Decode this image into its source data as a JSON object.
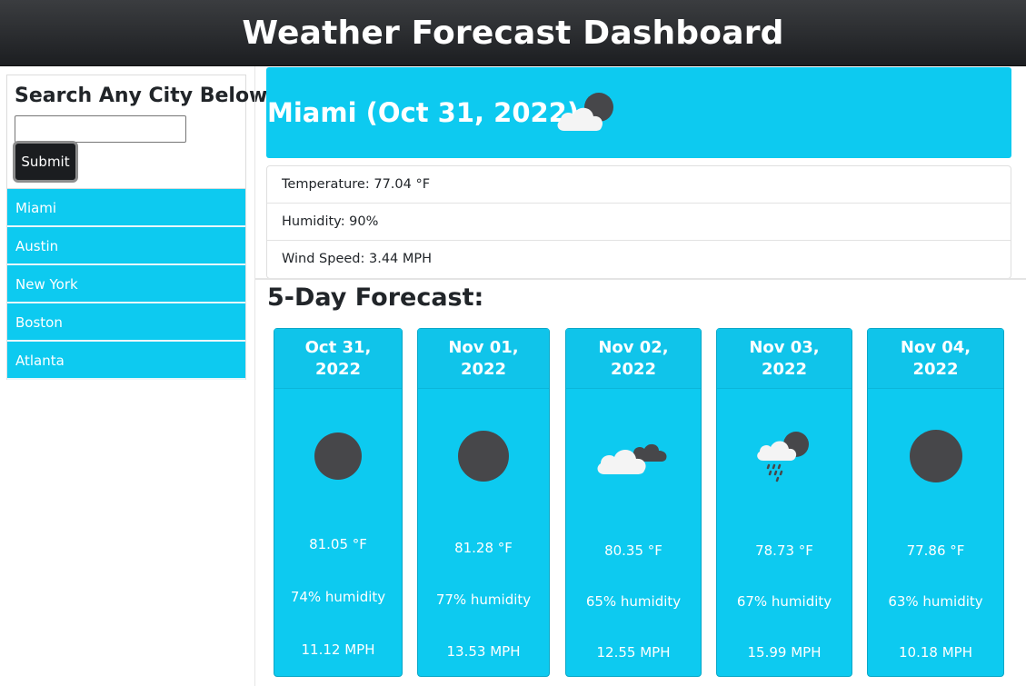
{
  "header": {
    "title": "Weather Forecast Dashboard"
  },
  "search": {
    "title": "Search Any City Below",
    "input_value": "",
    "placeholder": "",
    "submit_label": "Submit"
  },
  "history": {
    "items": [
      {
        "label": "Miami"
      },
      {
        "label": "Austin"
      },
      {
        "label": "New York"
      },
      {
        "label": "Boston"
      },
      {
        "label": "Atlanta"
      }
    ]
  },
  "current": {
    "title": "Miami (Oct 31, 2022)",
    "icon": "clouds-icon",
    "temperature": "Temperature: 77.04 °F",
    "humidity": "Humidity: 90%",
    "wind": "Wind Speed: 3.44 MPH"
  },
  "forecast": {
    "title": "5-Day Forecast:",
    "days": [
      {
        "date": "Oct 31, 2022",
        "icon": "clear-night-icon",
        "temp": "81.05 °F",
        "humidity": "74% humidity",
        "wind": "11.12 MPH"
      },
      {
        "date": "Nov 01, 2022",
        "icon": "clear-night-icon",
        "temp": "81.28 °F",
        "humidity": "77% humidity",
        "wind": "13.53 MPH"
      },
      {
        "date": "Nov 02, 2022",
        "icon": "broken-clouds-icon",
        "temp": "80.35 °F",
        "humidity": "65% humidity",
        "wind": "12.55 MPH"
      },
      {
        "date": "Nov 03, 2022",
        "icon": "rain-night-icon",
        "temp": "78.73 °F",
        "humidity": "67% humidity",
        "wind": "15.99 MPH"
      },
      {
        "date": "Nov 04, 2022",
        "icon": "clear-night-icon",
        "temp": "77.86 °F",
        "humidity": "63% humidity",
        "wind": "10.18 MPH"
      }
    ]
  },
  "colors": {
    "accent": "#0dcaf0",
    "header_bg": "#2a2c2f",
    "moon": "#47474a",
    "cloud": "#f2f2f2"
  }
}
